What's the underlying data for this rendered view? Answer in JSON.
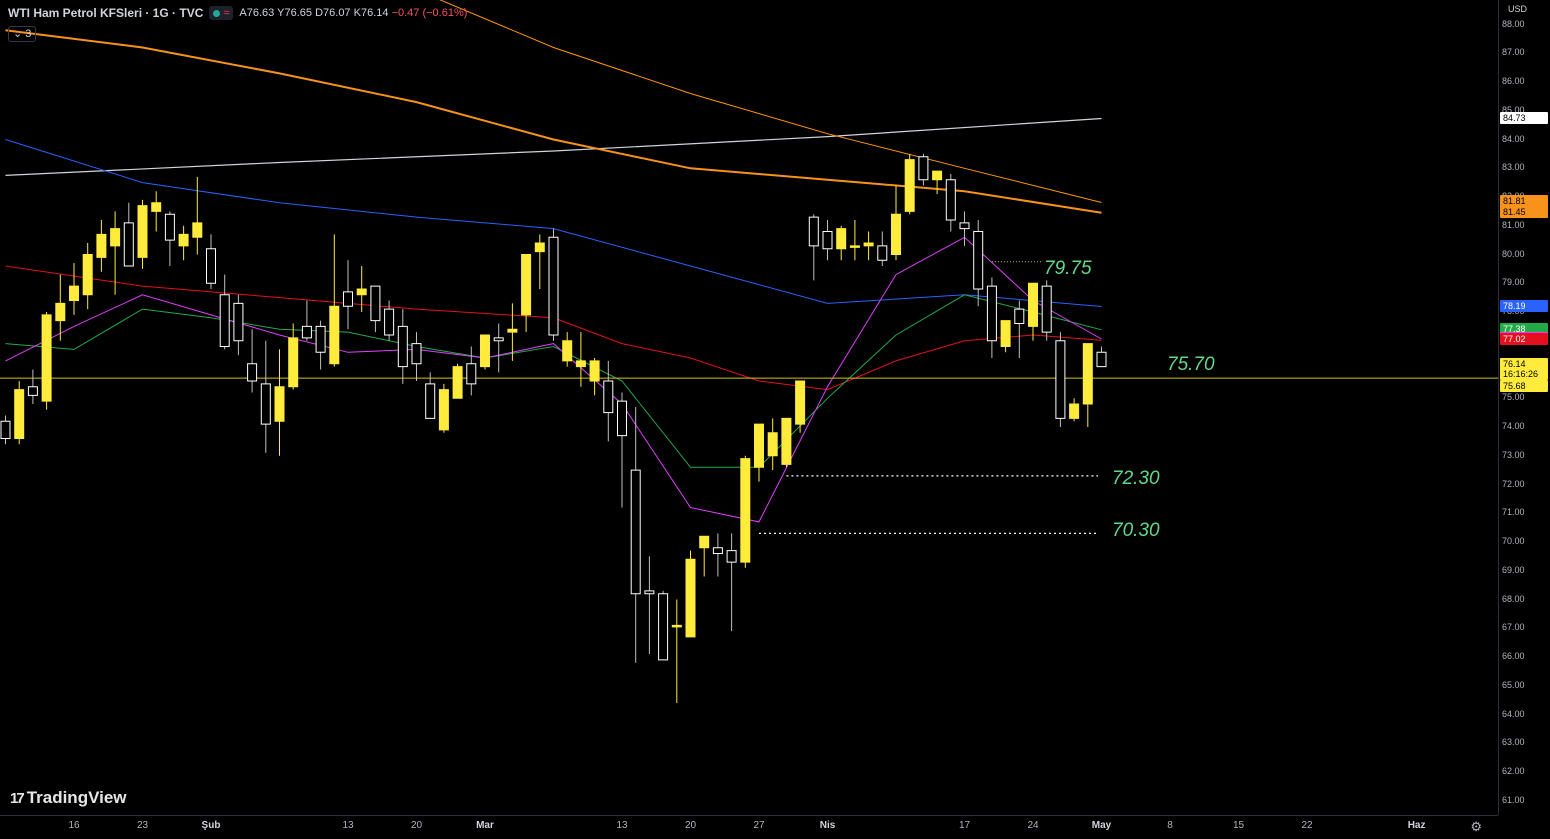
{
  "header": {
    "title": "WTI Ham Petrol KFSleri · 1G · TVC",
    "status_symbol": "≈",
    "ohlc": {
      "open": "A76.63",
      "high": "Y76.65",
      "low": "D76.07",
      "close": "K76.14",
      "change": "−0.47 (−0.61%)"
    },
    "indicators_toggle": "⌄ 3"
  },
  "logo": {
    "mark": "17",
    "text": "TradingView"
  },
  "currency": "USD",
  "price_axis": {
    "ticks": [
      "88.00",
      "87.00",
      "86.00",
      "85.00",
      "84.00",
      "83.00",
      "82.00",
      "81.00",
      "80.00",
      "79.00",
      "78.00",
      "77.00",
      "76.00",
      "75.00",
      "74.00",
      "73.00",
      "72.00",
      "71.00",
      "70.00",
      "69.00",
      "68.00",
      "67.00",
      "66.00",
      "65.00",
      "64.00",
      "63.00",
      "62.00",
      "61.00"
    ],
    "tags": [
      {
        "text": "84.73",
        "price": 84.73,
        "bg": "#ffffff",
        "fg": "#000000"
      },
      {
        "text": "81.81",
        "price": 81.81,
        "bg": "#f7931a",
        "fg": "#000000"
      },
      {
        "text": "81.45",
        "price": 81.45,
        "bg": "#f7931a",
        "fg": "#000000"
      },
      {
        "text": "78.19",
        "price": 78.19,
        "bg": "#2962ff",
        "fg": "#ffffff"
      },
      {
        "text": "77.38",
        "price": 77.38,
        "bg": "#22ab48",
        "fg": "#ffffff"
      },
      {
        "text": "77.06",
        "price": 77.06,
        "bg": "#e040fb",
        "fg": "#ffffff"
      },
      {
        "text": "77.02",
        "price": 77.02,
        "bg": "#e5101e",
        "fg": "#ffffff"
      },
      {
        "text": "76.14",
        "price": 76.14,
        "bg": "#ffeb3b",
        "fg": "#000000"
      },
      {
        "text": "16:16:26",
        "price": 75.8,
        "bg": "#ffeb3b",
        "fg": "#000000"
      },
      {
        "text": "75.68",
        "price": 75.4,
        "bg": "#ffeb3b",
        "fg": "#000000"
      }
    ]
  },
  "time_axis": {
    "labels": [
      {
        "text": "16",
        "bar": 5
      },
      {
        "text": "23",
        "bar": 10
      },
      {
        "text": "Şub",
        "bar": 15,
        "bold": true
      },
      {
        "text": "13",
        "bar": 25
      },
      {
        "text": "20",
        "bar": 30
      },
      {
        "text": "Mar",
        "bar": 35,
        "bold": true
      },
      {
        "text": "13",
        "bar": 45
      },
      {
        "text": "20",
        "bar": 50
      },
      {
        "text": "27",
        "bar": 55
      },
      {
        "text": "Nis",
        "bar": 60,
        "bold": true
      },
      {
        "text": "17",
        "bar": 70
      },
      {
        "text": "24",
        "bar": 75
      },
      {
        "text": "May",
        "bar": 80,
        "bold": true
      },
      {
        "text": "8",
        "bar": 85
      },
      {
        "text": "15",
        "bar": 90
      },
      {
        "text": "22",
        "bar": 95
      },
      {
        "text": "Haz",
        "bar": 103,
        "bold": true
      }
    ]
  },
  "annotations": {
    "level_79": "79.75",
    "level_75": "75.70",
    "level_72": "72.30",
    "level_70": "70.30"
  },
  "levels": {
    "current": 75.7,
    "support1": 72.3,
    "support2": 70.3,
    "resistance": 79.75
  },
  "colors": {
    "bull": "#ffeb3b",
    "bear": "#000000",
    "bear_border": "#ffffff",
    "wick": "#c0c0c0",
    "ma_gray": "#d1d4dc",
    "ma_orange": "#f7931a",
    "ma_orange_thin": "#ff9800",
    "ma_blue": "#2962ff",
    "ma_red": "#e5101e",
    "ma_green": "#22ab48",
    "ma_magenta": "#e040fb",
    "hline": "#d4c21a"
  },
  "chart_data": {
    "type": "candlestick",
    "ohlc": [
      [
        74.2,
        74.4,
        73.4,
        73.6
      ],
      [
        73.6,
        75.6,
        73.4,
        75.3
      ],
      [
        75.4,
        76.0,
        74.8,
        75.1
      ],
      [
        74.9,
        78.0,
        74.6,
        77.9
      ],
      [
        77.7,
        79.3,
        77.0,
        78.3
      ],
      [
        78.4,
        79.7,
        77.9,
        78.9
      ],
      [
        78.6,
        80.4,
        78.1,
        80.0
      ],
      [
        79.9,
        81.2,
        79.4,
        80.7
      ],
      [
        80.3,
        81.5,
        78.6,
        80.9
      ],
      [
        81.1,
        81.8,
        80.0,
        79.6
      ],
      [
        79.9,
        81.9,
        79.5,
        81.7
      ],
      [
        81.5,
        82.2,
        80.8,
        81.8
      ],
      [
        81.4,
        81.5,
        79.6,
        80.5
      ],
      [
        80.3,
        81.0,
        79.8,
        80.7
      ],
      [
        80.6,
        82.7,
        80.0,
        81.1
      ],
      [
        80.2,
        80.7,
        78.8,
        79.0
      ],
      [
        78.6,
        79.3,
        76.7,
        76.8
      ],
      [
        78.3,
        78.6,
        76.5,
        77.0
      ],
      [
        76.2,
        77.4,
        75.2,
        75.6
      ],
      [
        75.5,
        77.0,
        73.1,
        74.1
      ],
      [
        74.2,
        76.7,
        73.0,
        75.4
      ],
      [
        75.4,
        77.6,
        75.3,
        77.1
      ],
      [
        77.5,
        78.4,
        77.0,
        77.1
      ],
      [
        77.5,
        77.7,
        76.0,
        76.6
      ],
      [
        76.2,
        80.7,
        76.1,
        78.2
      ],
      [
        78.7,
        79.8,
        77.4,
        78.2
      ],
      [
        78.6,
        79.6,
        78.0,
        78.8
      ],
      [
        78.9,
        78.9,
        77.3,
        77.7
      ],
      [
        78.1,
        78.4,
        77.0,
        77.2
      ],
      [
        77.5,
        78.1,
        75.5,
        76.1
      ],
      [
        76.9,
        77.3,
        75.6,
        76.2
      ],
      [
        75.5,
        75.9,
        75.4,
        74.3
      ],
      [
        73.9,
        75.5,
        73.8,
        75.3
      ],
      [
        75.0,
        76.2,
        75.0,
        76.1
      ],
      [
        76.2,
        76.8,
        75.1,
        75.5
      ],
      [
        76.1,
        77.0,
        76.0,
        77.2
      ],
      [
        77.1,
        77.6,
        75.9,
        77.0
      ],
      [
        77.3,
        78.3,
        76.3,
        77.4
      ],
      [
        77.9,
        80.0,
        77.3,
        80.0
      ],
      [
        80.1,
        80.7,
        78.8,
        80.4
      ],
      [
        80.6,
        80.9,
        77.0,
        77.2
      ],
      [
        76.3,
        77.3,
        76.1,
        77.0
      ],
      [
        76.1,
        77.3,
        75.4,
        76.3
      ],
      [
        75.6,
        76.4,
        75.1,
        76.3
      ],
      [
        75.6,
        76.3,
        73.5,
        74.5
      ],
      [
        74.9,
        75.2,
        71.2,
        73.7
      ],
      [
        72.5,
        74.7,
        65.8,
        68.2
      ],
      [
        68.3,
        69.5,
        66.1,
        68.2
      ],
      [
        68.2,
        68.3,
        66.1,
        65.9
      ],
      [
        67.1,
        68.0,
        64.4,
        67.1
      ],
      [
        66.7,
        69.7,
        67.1,
        69.4
      ],
      [
        69.8,
        69.9,
        68.8,
        70.2
      ],
      [
        69.8,
        70.3,
        68.8,
        69.6
      ],
      [
        69.7,
        70.3,
        66.9,
        69.3
      ],
      [
        69.3,
        73.0,
        69.1,
        72.9
      ],
      [
        72.6,
        74.1,
        72.1,
        74.1
      ],
      [
        73.0,
        74.3,
        72.5,
        73.8
      ],
      [
        72.7,
        74.3,
        72.6,
        74.3
      ],
      [
        74.1,
        75.6,
        73.8,
        75.6
      ],
      [
        81.3,
        81.4,
        79.1,
        80.3
      ],
      [
        80.8,
        81.2,
        79.8,
        80.2
      ],
      [
        80.2,
        81.0,
        79.8,
        80.9
      ],
      [
        80.3,
        81.2,
        79.8,
        80.3
      ],
      [
        80.3,
        80.8,
        79.8,
        80.4
      ],
      [
        80.3,
        80.8,
        79.6,
        79.8
      ],
      [
        80.0,
        82.4,
        79.8,
        81.4
      ],
      [
        81.5,
        83.5,
        81.4,
        83.3
      ],
      [
        83.4,
        83.5,
        82.4,
        82.6
      ],
      [
        82.6,
        82.9,
        82.1,
        82.9
      ],
      [
        82.6,
        82.8,
        80.8,
        81.2
      ],
      [
        81.1,
        81.5,
        80.3,
        80.9
      ],
      [
        80.8,
        81.2,
        78.2,
        78.8
      ],
      [
        78.9,
        79.2,
        76.4,
        77.0
      ],
      [
        76.8,
        77.6,
        76.6,
        77.7
      ],
      [
        78.1,
        78.4,
        76.4,
        77.6
      ],
      [
        77.5,
        79.0,
        77.0,
        79.0
      ],
      [
        78.9,
        79.1,
        77.0,
        77.3
      ],
      [
        77.0,
        77.3,
        74.0,
        74.3
      ],
      [
        74.3,
        75.0,
        74.2,
        74.8
      ],
      [
        74.8,
        76.9,
        74.0,
        76.9
      ],
      [
        76.6,
        76.8,
        76.1,
        76.1
      ]
    ],
    "series": [
      {
        "name": "MA white",
        "color": "#d1d4dc",
        "points": [
          [
            0,
            82.75
          ],
          [
            20,
            83.2
          ],
          [
            40,
            83.6
          ],
          [
            60,
            84.1
          ],
          [
            80,
            84.73
          ]
        ]
      },
      {
        "name": "MA orange thick",
        "color": "#f7931a",
        "points": [
          [
            0,
            87.8
          ],
          [
            10,
            87.2
          ],
          [
            20,
            86.3
          ],
          [
            30,
            85.3
          ],
          [
            40,
            84.0
          ],
          [
            50,
            83.0
          ],
          [
            60,
            82.6
          ],
          [
            70,
            82.2
          ],
          [
            80,
            81.45
          ]
        ]
      },
      {
        "name": "MA orange thin",
        "color": "#ff9800",
        "points": [
          [
            31,
            89.0
          ],
          [
            40,
            87.2
          ],
          [
            50,
            85.6
          ],
          [
            60,
            84.2
          ],
          [
            70,
            83.0
          ],
          [
            80,
            81.81
          ]
        ]
      },
      {
        "name": "MA blue",
        "color": "#2962ff",
        "points": [
          [
            0,
            84.0
          ],
          [
            10,
            82.5
          ],
          [
            20,
            81.8
          ],
          [
            30,
            81.3
          ],
          [
            40,
            80.9
          ],
          [
            50,
            79.6
          ],
          [
            60,
            78.3
          ],
          [
            70,
            78.6
          ],
          [
            80,
            78.19
          ]
        ]
      },
      {
        "name": "MA red",
        "color": "#e5101e",
        "points": [
          [
            0,
            79.6
          ],
          [
            10,
            78.9
          ],
          [
            20,
            78.5
          ],
          [
            30,
            78.1
          ],
          [
            40,
            77.8
          ],
          [
            45,
            76.9
          ],
          [
            50,
            76.4
          ],
          [
            55,
            75.6
          ],
          [
            60,
            75.3
          ],
          [
            65,
            76.3
          ],
          [
            70,
            77.0
          ],
          [
            75,
            77.2
          ],
          [
            80,
            77.02
          ]
        ]
      },
      {
        "name": "MA green",
        "color": "#22ab48",
        "points": [
          [
            0,
            76.9
          ],
          [
            5,
            76.7
          ],
          [
            10,
            78.1
          ],
          [
            15,
            77.8
          ],
          [
            20,
            77.4
          ],
          [
            25,
            77.3
          ],
          [
            30,
            76.8
          ],
          [
            35,
            76.4
          ],
          [
            40,
            76.8
          ],
          [
            45,
            75.6
          ],
          [
            50,
            72.6
          ],
          [
            55,
            72.6
          ],
          [
            60,
            75.0
          ],
          [
            65,
            77.2
          ],
          [
            70,
            78.6
          ],
          [
            75,
            78.0
          ],
          [
            80,
            77.38
          ]
        ]
      },
      {
        "name": "MA magenta",
        "color": "#e040fb",
        "points": [
          [
            0,
            76.3
          ],
          [
            5,
            77.5
          ],
          [
            10,
            78.6
          ],
          [
            15,
            77.9
          ],
          [
            20,
            77.2
          ],
          [
            25,
            76.6
          ],
          [
            30,
            76.7
          ],
          [
            35,
            76.4
          ],
          [
            40,
            76.9
          ],
          [
            45,
            74.8
          ],
          [
            50,
            71.2
          ],
          [
            55,
            70.7
          ],
          [
            60,
            75.4
          ],
          [
            65,
            79.3
          ],
          [
            70,
            80.6
          ],
          [
            75,
            78.4
          ],
          [
            80,
            77.06
          ]
        ]
      }
    ],
    "xlabel": "",
    "ylabel": "",
    "ylim": [
      60.5,
      88.4
    ]
  }
}
